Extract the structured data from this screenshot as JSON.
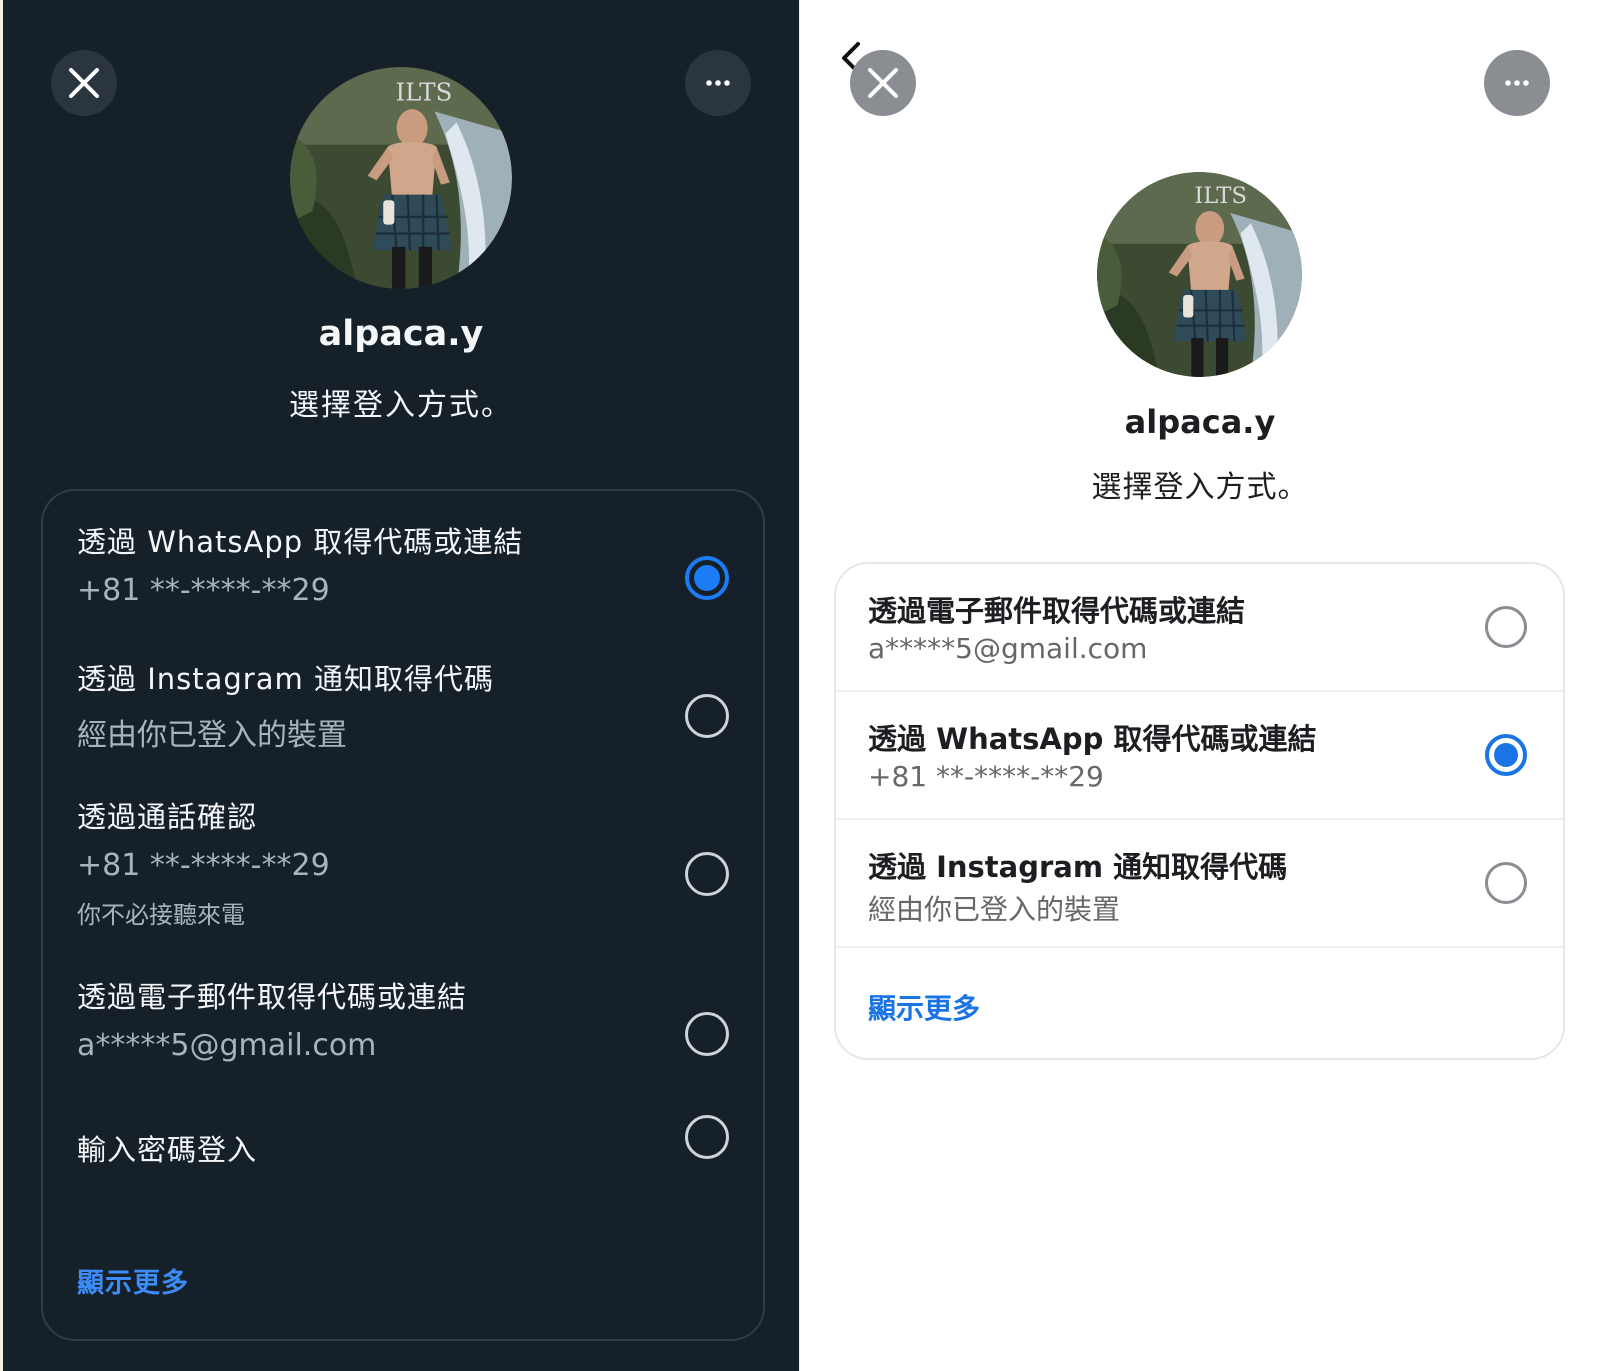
{
  "dark_panel": {
    "close_icon": "close-icon",
    "more_icon": "more-icon",
    "avatar_text": "ILTS",
    "username": "alpaca.y",
    "subtitle": "選擇登入方式。",
    "options": [
      {
        "title": "透過 WhatsApp 取得代碼或連結",
        "sub": "+81 **-****-**29",
        "selected": true
      },
      {
        "title": "透過 Instagram 通知取得代碼",
        "sub": "經由你已登入的裝置",
        "selected": false
      },
      {
        "title": "透過通話確認",
        "sub": "+81 **-****-**29",
        "note": "你不必接聽來電",
        "selected": false
      },
      {
        "title": "透過電子郵件取得代碼或連結",
        "sub": "a*****5@gmail.com",
        "selected": false
      },
      {
        "title": "輸入密碼登入",
        "selected": false
      }
    ],
    "show_more": "顯示更多",
    "accent": "#1b7cf5"
  },
  "light_panel": {
    "back_icon": "chevron-left-icon",
    "close_icon": "close-icon",
    "more_icon": "more-icon",
    "avatar_text": "ILTS",
    "username": "alpaca.y",
    "subtitle": "選擇登入方式。",
    "options": [
      {
        "title": "透過電子郵件取得代碼或連結",
        "sub": "a*****5@gmail.com",
        "selected": false
      },
      {
        "title": "透過 WhatsApp 取得代碼或連結",
        "sub": "+81 **-****-**29",
        "selected": true
      },
      {
        "title": "透過 Instagram 通知取得代碼",
        "sub": "經由你已登入的裝置",
        "selected": false
      }
    ],
    "show_more": "顯示更多",
    "accent": "#1b74e4"
  }
}
